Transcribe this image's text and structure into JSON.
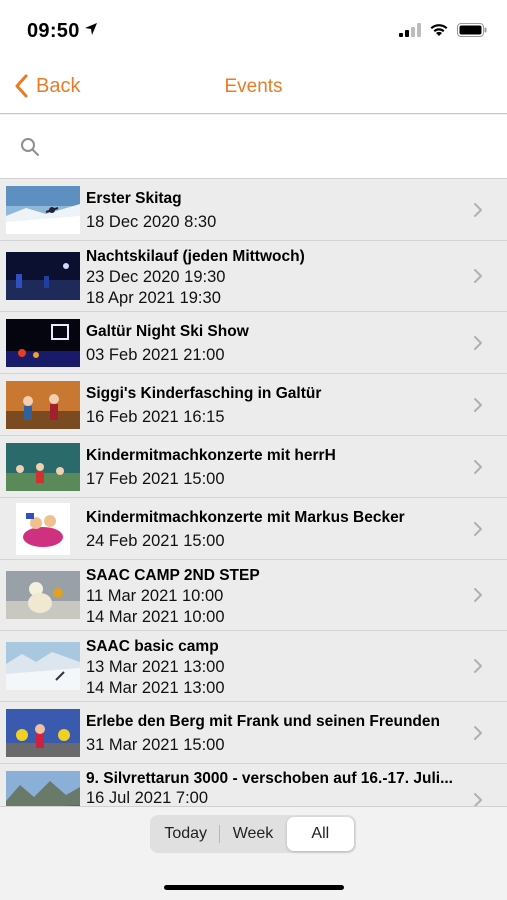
{
  "status_bar": {
    "time": "09:50"
  },
  "nav": {
    "back_label": "Back",
    "title": "Events"
  },
  "search": {
    "placeholder": ""
  },
  "events": [
    {
      "title": "Erster Skitag",
      "dates": [
        "18 Dec 2020 8:30"
      ]
    },
    {
      "title": "Nachtskilauf (jeden Mittwoch)",
      "dates": [
        "23 Dec 2020 19:30",
        "18 Apr 2021 19:30"
      ]
    },
    {
      "title": "Galtür Night Ski Show",
      "dates": [
        "03 Feb 2021 21:00"
      ]
    },
    {
      "title": "Siggi's Kinderfasching in Galtür",
      "dates": [
        "16 Feb 2021 16:15"
      ]
    },
    {
      "title": "Kindermitmachkonzerte mit herrH",
      "dates": [
        "17 Feb 2021 15:00"
      ]
    },
    {
      "title": "Kindermitmachkonzerte mit Markus Becker",
      "dates": [
        "24 Feb 2021 15:00"
      ]
    },
    {
      "title": "SAAC CAMP 2ND STEP",
      "dates": [
        "11 Mar 2021 10:00",
        "14 Mar 2021 10:00"
      ]
    },
    {
      "title": "SAAC basic camp",
      "dates": [
        "13 Mar 2021 13:00",
        "14 Mar 2021 13:00"
      ]
    },
    {
      "title": "Erlebe den Berg mit Frank und seinen Freunden",
      "dates": [
        "31 Mar 2021 15:00"
      ]
    },
    {
      "title": "9. Silvrettarun 3000  - verschoben auf 16.-17. Juli...",
      "dates": [
        "16 Jul 2021 7:00"
      ]
    }
  ],
  "filter": {
    "options": [
      "Today",
      "Week",
      "All"
    ],
    "selected": "All"
  },
  "colors": {
    "accent": "#e97b24"
  }
}
